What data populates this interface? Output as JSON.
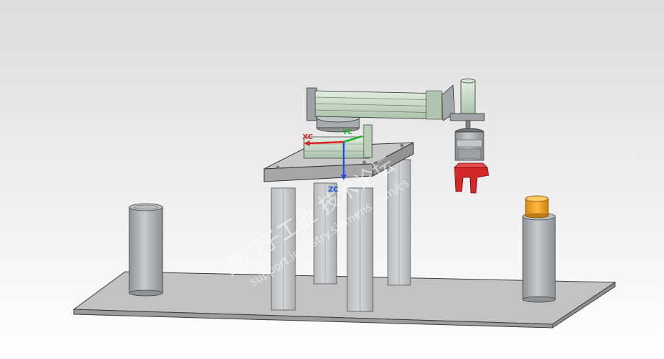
{
  "viewport": {
    "background_top": "#dcdcdc",
    "background_bottom": "#ffffff"
  },
  "triad": {
    "x_label": "XC",
    "y_label": "YC",
    "z_label": "ZC",
    "x_color": "#e02020",
    "y_color": "#20b020",
    "z_color": "#2050e0"
  },
  "watermark": {
    "line1": "西门子工业 技术论坛",
    "line2": "support.industry.siemens.com/cs"
  },
  "colors": {
    "base_plate": "#bdbdbd",
    "column": "#c4c6c8",
    "cylinder_grey": "#a8acaf",
    "arm_green": "#c9dcc9",
    "gripper_red": "#d62828",
    "workpiece_orange": "#f0a020"
  }
}
